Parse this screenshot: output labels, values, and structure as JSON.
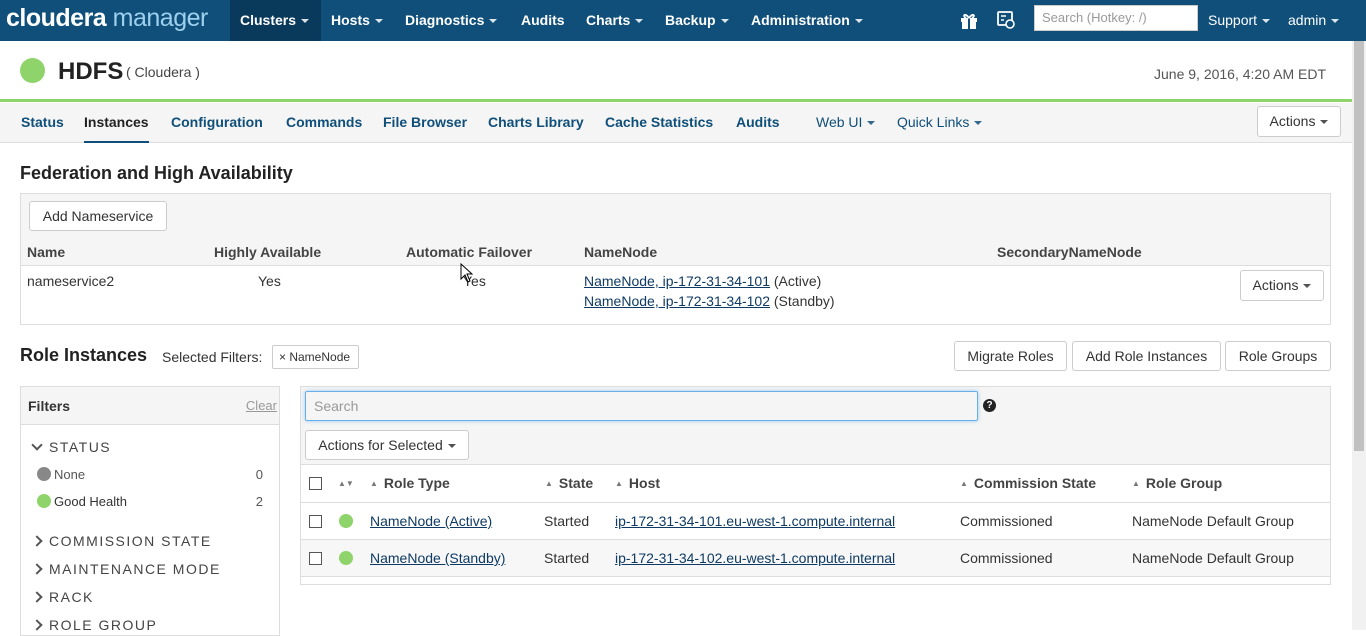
{
  "topbar": {
    "logo_bold": "cloudera",
    "logo_light": "manager",
    "nav": [
      "Clusters",
      "Hosts",
      "Diagnostics",
      "Audits",
      "Charts",
      "Backup",
      "Administration"
    ],
    "search_placeholder": "Search (Hotkey: /)",
    "support": "Support",
    "user": "admin"
  },
  "service": {
    "name": "HDFS",
    "cluster": "( Cloudera )",
    "date": "June 9, 2016, 4:20 AM EDT",
    "health_color": "#8ed46a"
  },
  "subtabs": [
    "Status",
    "Instances",
    "Configuration",
    "Commands",
    "File Browser",
    "Charts Library",
    "Cache Statistics",
    "Audits"
  ],
  "subtab_menus": [
    "Web UI",
    "Quick Links"
  ],
  "actions_label": "Actions",
  "federation": {
    "title": "Federation and High Availability",
    "add_button": "Add Nameservice",
    "headers": [
      "Name",
      "Highly Available",
      "Automatic Failover",
      "NameNode",
      "SecondaryNameNode"
    ],
    "row": {
      "name": "nameservice2",
      "highly_available": "Yes",
      "automatic_failover": "Yes",
      "namenode1_link": "NameNode, ip-172-31-34-101",
      "namenode1_state": "(Active)",
      "namenode2_link": "NameNode, ip-172-31-34-102",
      "namenode2_state": "(Standby)",
      "actions": "Actions"
    }
  },
  "roles": {
    "title": "Role Instances",
    "selected_filters_label": "Selected Filters:",
    "filter_chip": "× NameNode",
    "migrate": "Migrate Roles",
    "add": "Add Role Instances",
    "groups": "Role Groups",
    "search_placeholder": "Search",
    "actions_selected": "Actions for Selected",
    "headers": [
      "Role Type",
      "State",
      "Host",
      "Commission State",
      "Role Group"
    ],
    "rows": [
      {
        "role": "NameNode (Active)",
        "state": "Started",
        "host": "ip-172-31-34-101.eu-west-1.compute.internal",
        "commission": "Commissioned",
        "group": "NameNode Default Group"
      },
      {
        "role": "NameNode (Standby)",
        "state": "Started",
        "host": "ip-172-31-34-102.eu-west-1.compute.internal",
        "commission": "Commissioned",
        "group": "NameNode Default Group"
      }
    ]
  },
  "filters": {
    "title": "Filters",
    "clear": "Clear",
    "status_group": "STATUS",
    "status_items": [
      {
        "label": "None",
        "count": "0",
        "color": "#888888"
      },
      {
        "label": "Good Health",
        "count": "2",
        "color": "#8ed46a"
      }
    ],
    "groups": [
      "COMMISSION STATE",
      "MAINTENANCE MODE",
      "RACK",
      "ROLE GROUP"
    ]
  }
}
